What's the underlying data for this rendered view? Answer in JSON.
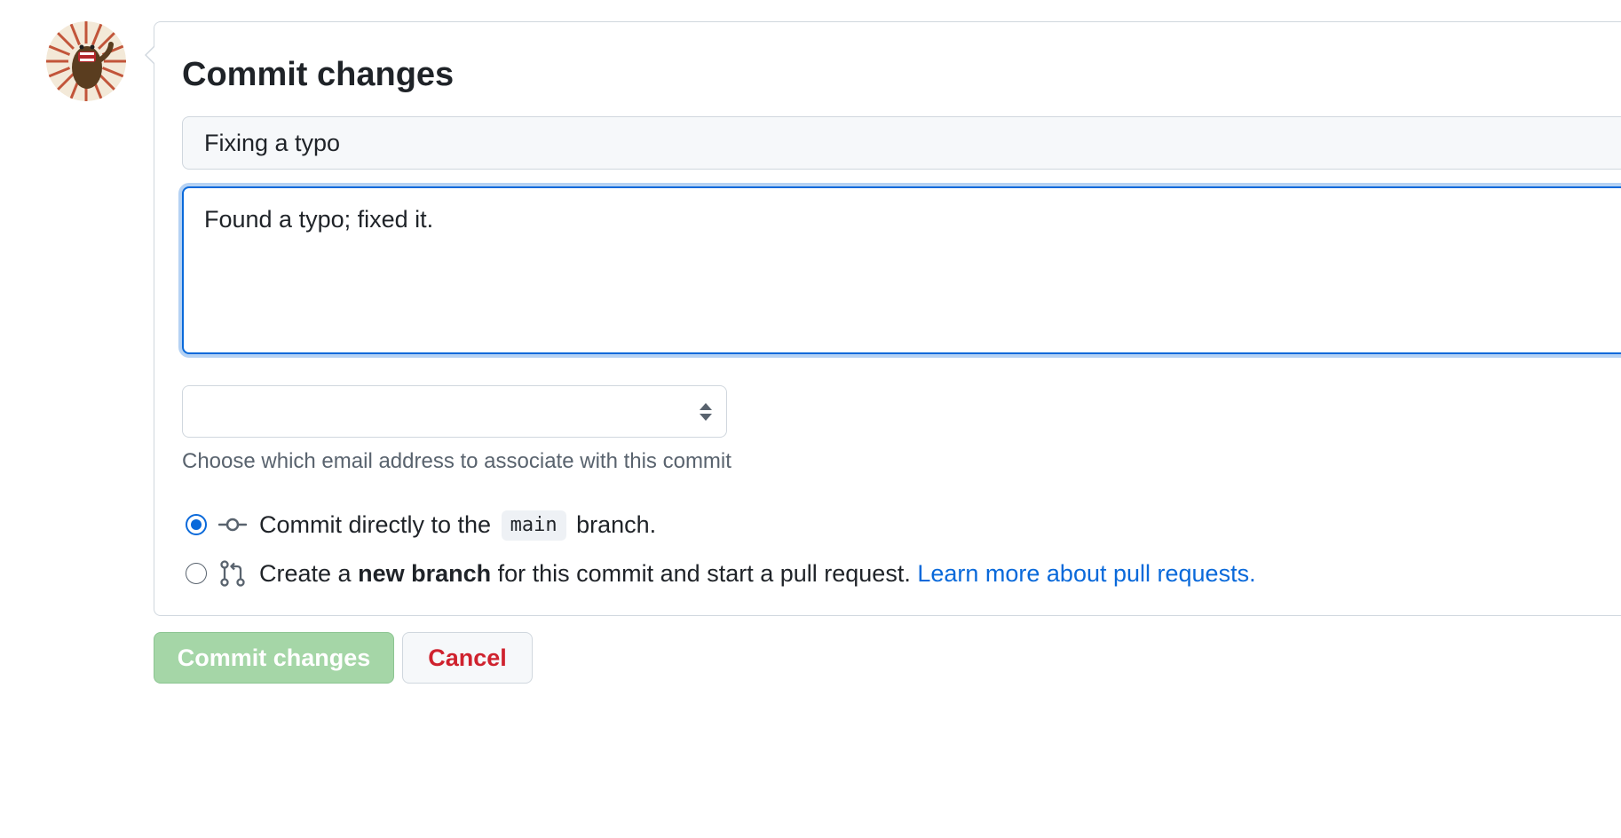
{
  "avatar": {
    "alt": "avatar"
  },
  "form": {
    "title": "Commit changes",
    "summary_value": "Fixing a typo",
    "description_value": "Found a typo; fixed it.",
    "email_select_value": "",
    "email_help": "Choose which email address to associate with this commit"
  },
  "options": {
    "direct": {
      "selected": true,
      "prefix": "Commit directly to the",
      "branch": "main",
      "suffix": "branch."
    },
    "new_branch": {
      "selected": false,
      "prefix": "Create a",
      "bold": "new branch",
      "middle": "for this commit and start a pull request.",
      "link": "Learn more about pull requests."
    }
  },
  "buttons": {
    "commit_label": "Commit changes",
    "cancel_label": "Cancel"
  },
  "colors": {
    "accent": "#0969da",
    "commit_disabled": "#a5d6a7",
    "danger": "#cf222e",
    "border": "#d0d7de"
  },
  "icons": {
    "direct": "git-commit-icon",
    "new_branch": "git-pull-request-icon",
    "select": "select-arrows-icon"
  }
}
